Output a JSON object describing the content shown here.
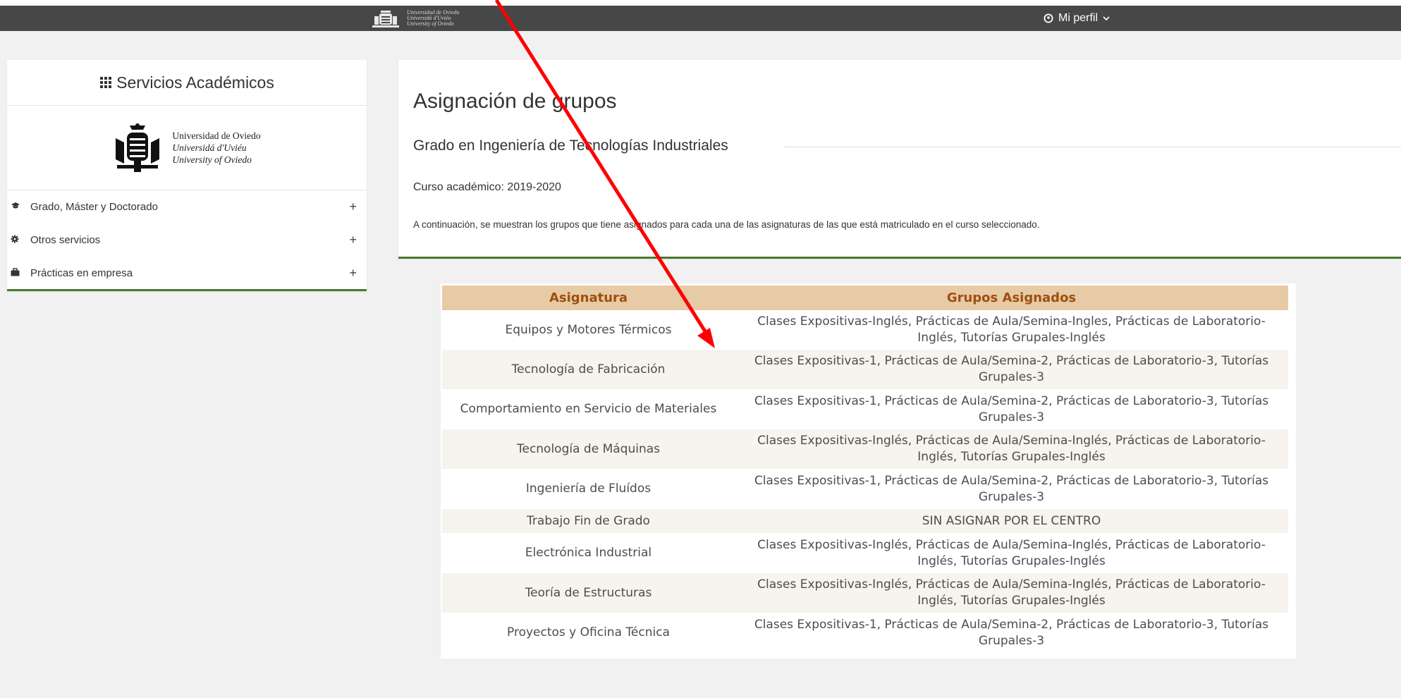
{
  "topbar": {
    "logo_lines": [
      "Universidad de Oviedo",
      "Universidá d'Uviéu",
      "University of Oviedo"
    ],
    "profile_label": "Mi perfil",
    "profile_icon": "user-circle-icon",
    "chevron_icon": "chevron-down-icon"
  },
  "sidebar": {
    "title": "Servicios Académicos",
    "title_icon": "grid-icon",
    "logo": {
      "line1": "Universidad de Oviedo",
      "line2": "Universidá d'Uviéu",
      "line3": "University of Oviedo"
    },
    "items": [
      {
        "label": "Grado, Máster y Doctorado",
        "icon": "graduation-cap-icon"
      },
      {
        "label": "Otros servicios",
        "icon": "gear-icon"
      },
      {
        "label": "Prácticas en empresa",
        "icon": "briefcase-icon"
      }
    ],
    "expand_symbol": "+"
  },
  "main": {
    "title": "Asignación de grupos",
    "degree": "Grado en Ingeniería de Tecnologías Industriales",
    "course": "Curso académico: 2019-2020",
    "intro": "A continuación, se muestran los grupos que tiene asignados para cada una de las asignaturas de las que está matriculado en el curso seleccionado."
  },
  "table": {
    "headers": [
      "Asignatura",
      "Grupos Asignados"
    ],
    "rows": [
      [
        "Equipos y Motores Térmicos",
        "Clases Expositivas-Inglés, Prácticas de Aula/Semina-Ingles, Prácticas de Laboratorio-Inglés, Tutorías Grupales-Inglés"
      ],
      [
        "Tecnología de Fabricación",
        "Clases Expositivas-1, Prácticas de Aula/Semina-2, Prácticas de Laboratorio-3, Tutorías Grupales-3"
      ],
      [
        "Comportamiento en Servicio de Materiales",
        "Clases Expositivas-1, Prácticas de Aula/Semina-2, Prácticas de Laboratorio-3, Tutorías Grupales-3"
      ],
      [
        "Tecnología de Máquinas",
        "Clases Expositivas-Inglés, Prácticas de Aula/Semina-Inglés, Prácticas de Laboratorio-Inglés, Tutorías Grupales-Inglés"
      ],
      [
        "Ingeniería de Fluídos",
        "Clases Expositivas-1, Prácticas de Aula/Semina-2, Prácticas de Laboratorio-3, Tutorías Grupales-3"
      ],
      [
        "Trabajo Fin de Grado",
        "SIN ASIGNAR POR EL CENTRO"
      ],
      [
        "Electrónica Industrial",
        "Clases Expositivas-Inglés, Prácticas de Aula/Semina-Inglés, Prácticas de Laboratorio-Inglés, Tutorías Grupales-Inglés"
      ],
      [
        "Teoría de Estructuras",
        "Clases Expositivas-Inglés, Prácticas de Aula/Semina-Inglés, Prácticas de Laboratorio-Inglés, Tutorías Grupales-Inglés"
      ],
      [
        "Proyectos y Oficina Técnica",
        "Clases Expositivas-1, Prácticas de Aula/Semina-2, Prácticas de Laboratorio-3, Tutorías Grupales-3"
      ]
    ]
  },
  "colors": {
    "topbar": "#474747",
    "accent_green": "#4a7a2f",
    "header_bg": "#e7caa6",
    "header_text": "#9e4f0e",
    "annotation_arrow": "#ff0000"
  }
}
